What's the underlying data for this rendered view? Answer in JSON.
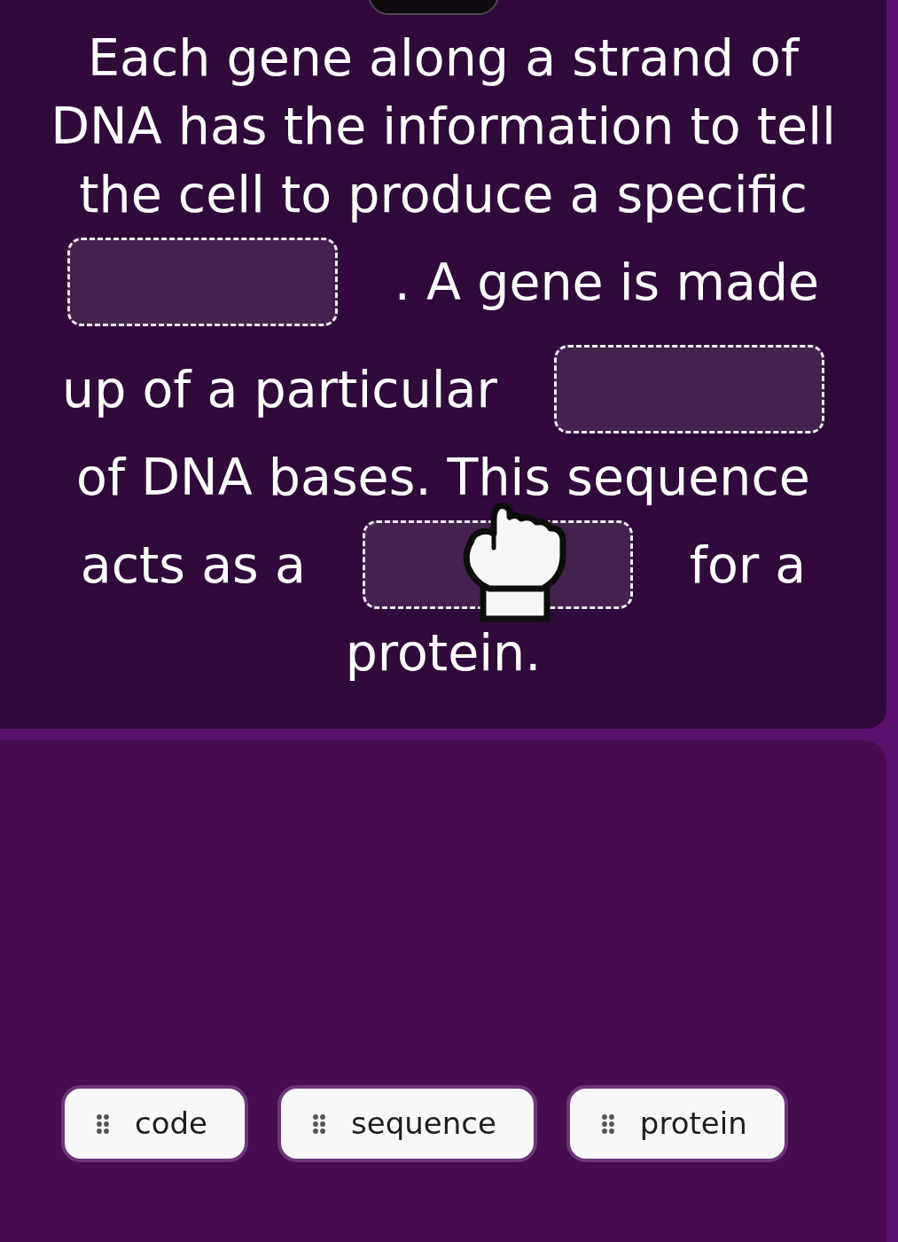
{
  "question": {
    "segments": [
      {
        "kind": "text",
        "text": "Each gene along a strand of"
      },
      {
        "kind": "text",
        "text": "DNA has the information to tell"
      },
      {
        "kind": "text",
        "text": "the cell to produce a specific"
      },
      {
        "kind": "blank",
        "hovered": false
      },
      {
        "kind": "text",
        "text": ". A gene is made"
      },
      {
        "kind": "text",
        "text": "up of a particular"
      },
      {
        "kind": "blank",
        "hovered": false
      },
      {
        "kind": "text",
        "text": "of DNA bases. This sequence"
      },
      {
        "kind": "text",
        "text": "acts as a"
      },
      {
        "kind": "blank",
        "hovered": true
      },
      {
        "kind": "text",
        "text": "for a"
      },
      {
        "kind": "text",
        "text": "protein."
      }
    ]
  },
  "word_bank": {
    "words": [
      {
        "text": "code"
      },
      {
        "text": "sequence"
      },
      {
        "text": "protein"
      }
    ]
  }
}
